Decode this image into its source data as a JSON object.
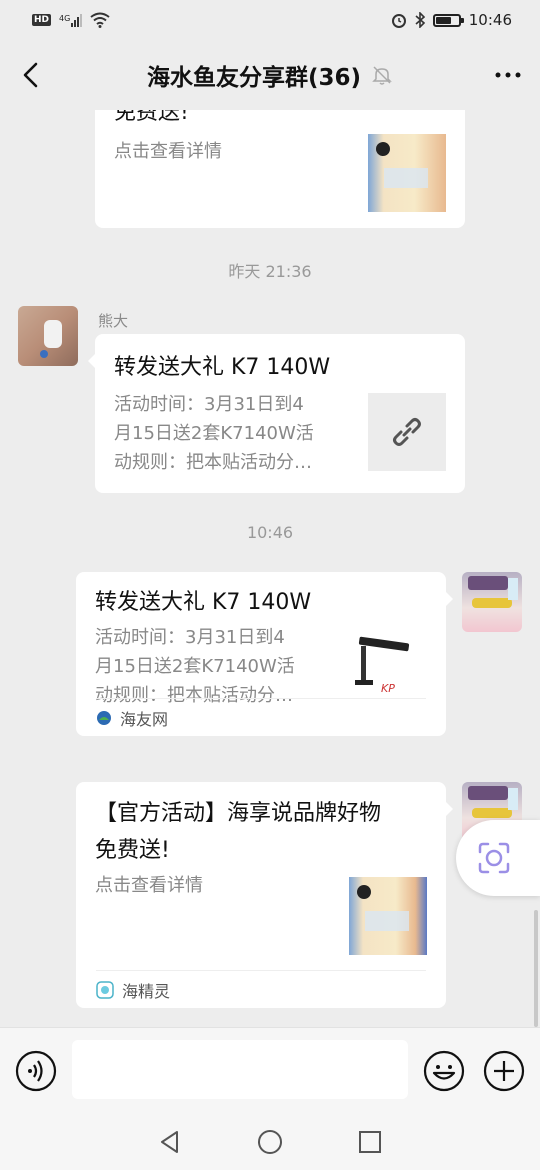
{
  "status_bar": {
    "hd": "HD",
    "network": "4G",
    "time": "10:46"
  },
  "header": {
    "title": "海水鱼友分享群(36)",
    "mute_icon": "bell-off-icon"
  },
  "messages": {
    "partial_card": {
      "heading_tail": "免费送!",
      "desc": "点击查看详情"
    },
    "timestamp_1": "昨天 21:36",
    "msg1": {
      "sender": "熊大",
      "title": "转发送大礼 K7 140W",
      "desc": "活动时间：3月31日到4月15日送2套K7140W活动规则：把本贴活动分…",
      "desc_lines": [
        "活动时间：3月31日到4",
        "月15日送2套K7140W活",
        "动规则：把本贴活动分…"
      ],
      "thumb_icon": "link-icon"
    },
    "timestamp_2": "10:46",
    "msg2": {
      "title": "转发送大礼 K7 140W",
      "desc_lines": [
        "活动时间：3月31日到4",
        "月15日送2套K7140W活",
        "动规则：把本贴活动分…"
      ],
      "source": "海友网"
    },
    "msg3": {
      "title_lines": [
        "【官方活动】海享说品牌好物",
        "免费送!"
      ],
      "desc": "点击查看详情",
      "source": "海精灵"
    }
  },
  "input_bar": {
    "voice_icon": "voice-icon",
    "emoji_icon": "emoji-icon",
    "plus_icon": "plus-icon"
  },
  "colors": {
    "background": "#ededed",
    "card": "#ffffff",
    "muted_text": "#888888"
  }
}
